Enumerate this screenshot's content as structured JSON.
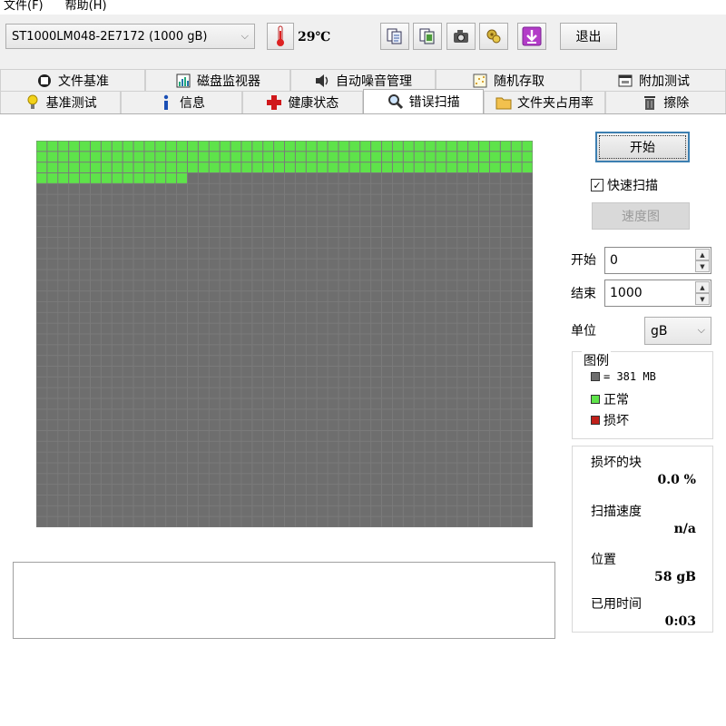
{
  "menu": {
    "file": "文件(F)",
    "help": "帮助(H)"
  },
  "toolbar": {
    "drive": "ST1000LM048-2E7172 (1000 gB)",
    "temperature": "29℃",
    "exit": "退出",
    "icons": [
      "copy-text-icon",
      "copy-image-icon",
      "camera-icon",
      "options-icon",
      "save-icon"
    ]
  },
  "tabs_row1": [
    {
      "label": "文件基准",
      "icon": "file-benchmark-icon"
    },
    {
      "label": "磁盘监视器",
      "icon": "disk-monitor-icon"
    },
    {
      "label": "自动噪音管理",
      "icon": "speaker-icon"
    },
    {
      "label": "随机存取",
      "icon": "random-access-icon"
    },
    {
      "label": "附加测试",
      "icon": "extra-tests-icon"
    }
  ],
  "tabs_row2": [
    {
      "label": "基准测试",
      "icon": "bulb-icon"
    },
    {
      "label": "信息",
      "icon": "info-icon"
    },
    {
      "label": "健康状态",
      "icon": "health-cross-icon"
    },
    {
      "label": "错误扫描",
      "icon": "magnifier-icon",
      "active": true
    },
    {
      "label": "文件夹占用率",
      "icon": "folder-icon"
    },
    {
      "label": "擦除",
      "icon": "trash-icon"
    }
  ],
  "scan": {
    "start_label": "开始",
    "quick_scan_label": "快速扫描",
    "quick_scan_checked": true,
    "speed_map_label": "速度图",
    "range_start_label": "开始",
    "range_start_value": "0",
    "range_end_label": "结束",
    "range_end_value": "1000",
    "unit_label": "单位",
    "unit_value": "gB"
  },
  "legend": {
    "title": "图例",
    "block_size": "= 381 MB",
    "ok": "正常",
    "damaged": "损坏",
    "colors": {
      "untested": "#6e6e6e",
      "ok": "#5ee34a",
      "damaged": "#c0201a"
    }
  },
  "stats": {
    "damaged_label": "损坏的块",
    "damaged_value": "0.0 %",
    "speed_label": "扫描速度",
    "speed_value": "n/a",
    "position_label": "位置",
    "position_value": "58 gB",
    "elapsed_label": "已用时间",
    "elapsed_value": "0:03"
  },
  "block_map": {
    "columns": 46,
    "rows": 36,
    "ok_blocks": 152
  }
}
